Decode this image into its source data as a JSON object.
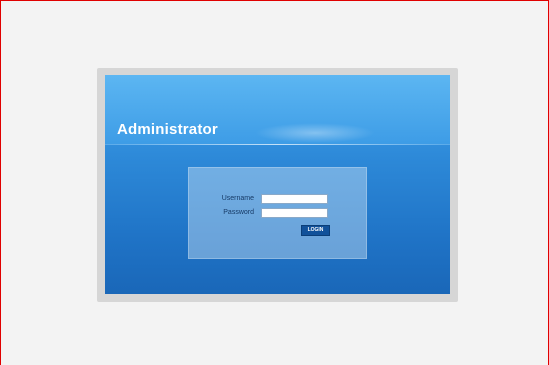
{
  "header": {
    "title": "Administrator"
  },
  "login_form": {
    "username_label": "Username",
    "password_label": "Password",
    "username_value": "",
    "password_value": "",
    "login_button_label": "LOGIN"
  },
  "colors": {
    "page_border": "#e00000",
    "page_background": "#f3f3f3",
    "card_blue_top": "#42a5ee",
    "card_blue_bottom": "#1a67b8",
    "login_button": "#11519a"
  }
}
